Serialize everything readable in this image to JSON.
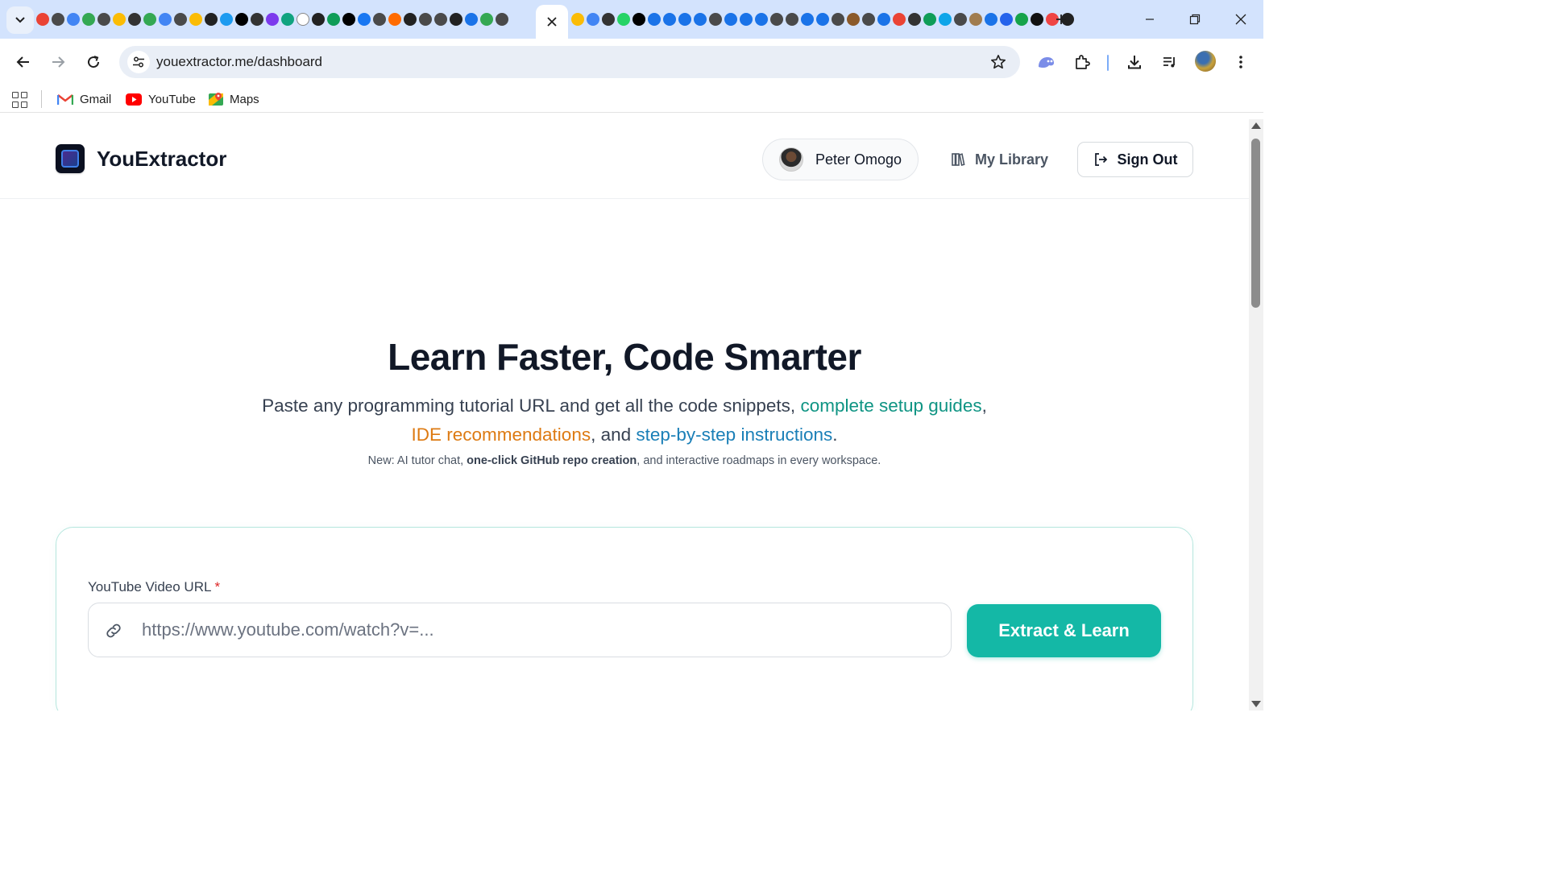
{
  "browser": {
    "address_url": "youextractor.me/dashboard",
    "bookmarks": [
      {
        "label": "Gmail",
        "icon": "gmail-icon"
      },
      {
        "label": "YouTube",
        "icon": "youtube-icon"
      },
      {
        "label": "Maps",
        "icon": "maps-icon"
      }
    ],
    "tab_favicon_colors": [
      "#ea4335",
      "#4a4a4a",
      "#4285f4",
      "#34a853",
      "#4a4a4a",
      "#fbbc05",
      "#333333",
      "#34a853",
      "#4285f4",
      "#4a4a4a",
      "#fbbc05",
      "#222222",
      "#1d9bf0",
      "#000000",
      "#333333",
      "#7c3aed",
      "#10a37f",
      "#ffffff",
      "#222222",
      "#0f9d58",
      "#000000",
      "#1877f2",
      "#4a4a4a",
      "#ff6b00",
      "#222222",
      "#4a4a4a",
      "#4a4a4a",
      "#222222",
      "#1a73e8",
      "#34a853",
      "#4a4a4a"
    ],
    "tab_favicon_colors_2": [
      "#fbbc05",
      "#4285f4",
      "#333333",
      "#25d366",
      "#000000",
      "#1a73e8",
      "#1a73e8",
      "#1a73e8",
      "#1a73e8",
      "#4a4a4a",
      "#1a73e8",
      "#1a73e8",
      "#1a73e8",
      "#4a4a4a",
      "#4a4a4a",
      "#1a73e8",
      "#1a73e8",
      "#4a4a4a",
      "#8b5a2b",
      "#4a4a4a",
      "#1a73e8",
      "#ea4335",
      "#333333",
      "#0f9d58",
      "#0ea5e9",
      "#4a4a4a",
      "#a07c4f",
      "#1a73e8",
      "#2563eb",
      "#16a34a",
      "#111111",
      "#ef4444",
      "#222222"
    ]
  },
  "site": {
    "brand": "YouExtractor",
    "user_name": "Peter Omogo",
    "library_label": "My Library",
    "signout_label": "Sign Out"
  },
  "hero": {
    "title": "Learn Faster, Code Smarter",
    "sub_1": "Paste any programming tutorial URL and get all the code snippets, ",
    "sub_hl_1": "complete setup guides",
    "sub_2": ",",
    "sub_hl_2": "IDE recommendations",
    "sub_3": ", and ",
    "sub_hl_3": "step-by-step instructions",
    "sub_4": ".",
    "note_1": "New: AI tutor chat, ",
    "note_bold": "one-click GitHub repo creation",
    "note_2": ", and interactive roadmaps in every workspace."
  },
  "form": {
    "label": "YouTube Video URL",
    "required_mark": "*",
    "placeholder": "https://www.youtube.com/watch?v=...",
    "value": "",
    "submit_label": "Extract & Learn"
  },
  "colors": {
    "accent_teal": "#14b8a6",
    "highlight_teal": "#0e9483",
    "highlight_orange": "#dd7a12",
    "highlight_blue": "#1a7fb7",
    "tab_strip": "#d3e3fd"
  }
}
